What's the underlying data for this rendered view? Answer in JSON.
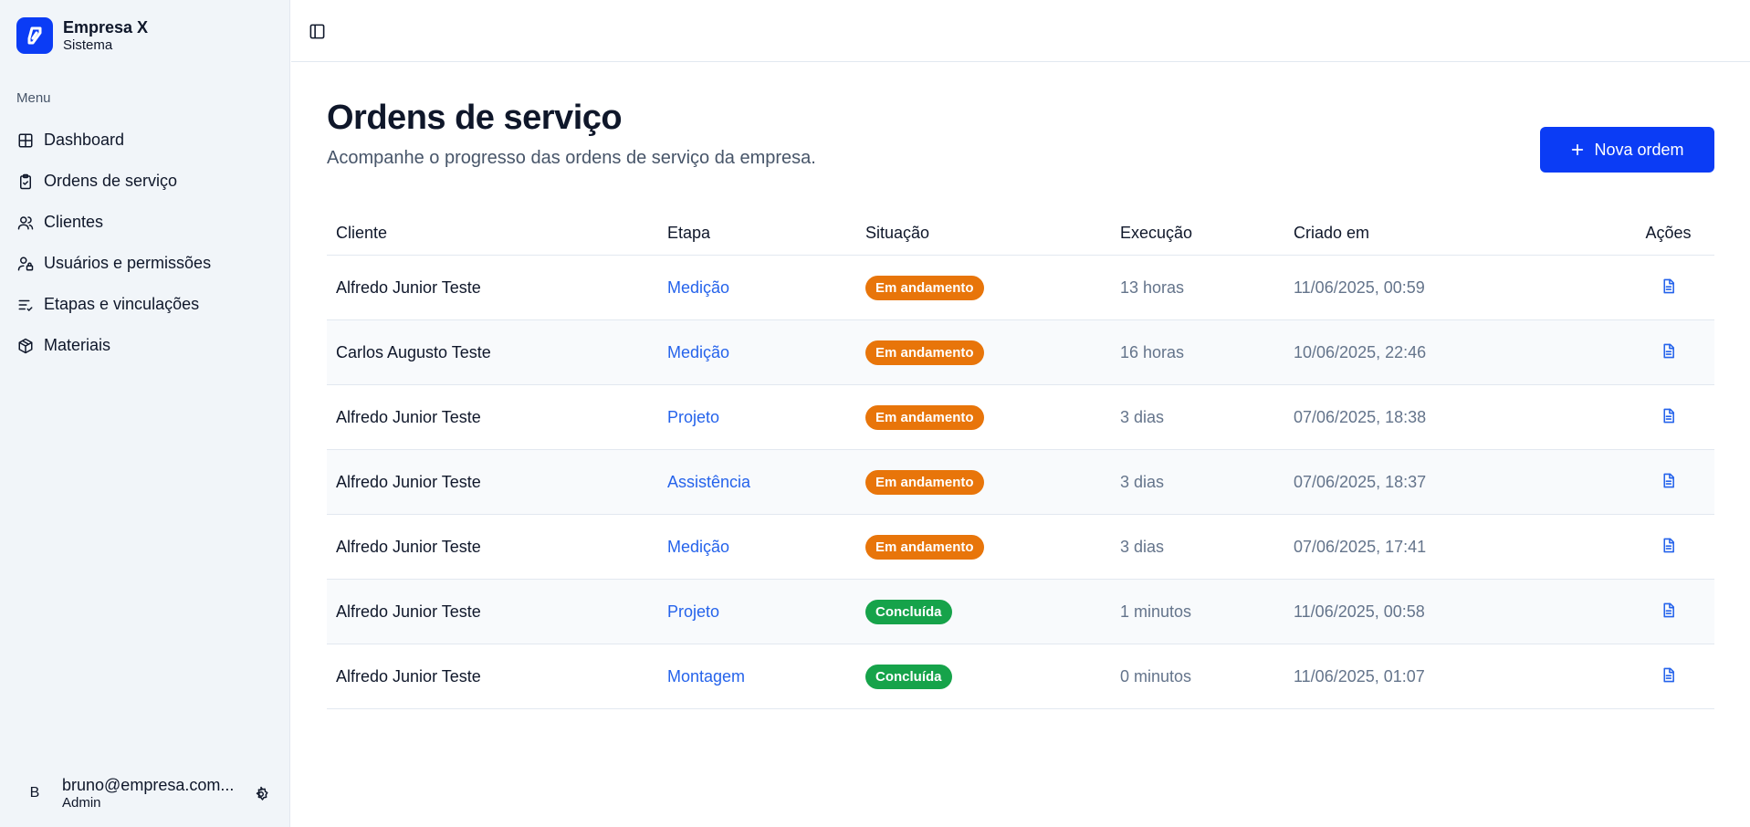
{
  "brand": {
    "name": "Empresa X",
    "subtitle": "Sistema",
    "color": "#0b3cf5"
  },
  "menu": {
    "title": "Menu",
    "items": [
      {
        "label": "Dashboard",
        "icon": "grid-icon"
      },
      {
        "label": "Ordens de serviço",
        "icon": "clipboard-check-icon"
      },
      {
        "label": "Clientes",
        "icon": "users-icon"
      },
      {
        "label": "Usuários e permissões",
        "icon": "user-lock-icon"
      },
      {
        "label": "Etapas e vinculações",
        "icon": "list-check-icon"
      },
      {
        "label": "Materiais",
        "icon": "package-icon"
      }
    ]
  },
  "user": {
    "initial": "B",
    "email": "bruno@empresa.com...",
    "role": "Admin",
    "settings_icon": "gear-icon"
  },
  "header": {
    "toggle_icon": "sidebar-toggle-icon"
  },
  "page": {
    "title": "Ordens de serviço",
    "subtitle": "Acompanhe o progresso das ordens de serviço da empresa.",
    "new_button": "Nova ordem"
  },
  "table": {
    "headers": {
      "client": "Cliente",
      "stage": "Etapa",
      "status": "Situação",
      "execution": "Execução",
      "created": "Criado em",
      "actions": "Ações"
    },
    "rows": [
      {
        "client": "Alfredo Junior Teste",
        "stage": "Medição",
        "status": "Em andamento",
        "execution": "13 horas",
        "created": "11/06/2025, 00:59"
      },
      {
        "client": "Carlos Augusto Teste",
        "stage": "Medição",
        "status": "Em andamento",
        "execution": "16 horas",
        "created": "10/06/2025, 22:46"
      },
      {
        "client": "Alfredo Junior Teste",
        "stage": "Projeto",
        "status": "Em andamento",
        "execution": "3 dias",
        "created": "07/06/2025, 18:38"
      },
      {
        "client": "Alfredo Junior Teste",
        "stage": "Assistência",
        "status": "Em andamento",
        "execution": "3 dias",
        "created": "07/06/2025, 18:37"
      },
      {
        "client": "Alfredo Junior Teste",
        "stage": "Medição",
        "status": "Em andamento",
        "execution": "3 dias",
        "created": "07/06/2025, 17:41"
      },
      {
        "client": "Alfredo Junior Teste",
        "stage": "Projeto",
        "status": "Concluída",
        "execution": "1 minutos",
        "created": "11/06/2025, 00:58"
      },
      {
        "client": "Alfredo Junior Teste",
        "stage": "Montagem",
        "status": "Concluída",
        "execution": "0 minutos",
        "created": "11/06/2025, 01:07"
      }
    ]
  },
  "colors": {
    "accent": "#0b3cf5",
    "link": "#2563eb",
    "in_progress": "#e8750a",
    "done": "#16a34a"
  }
}
